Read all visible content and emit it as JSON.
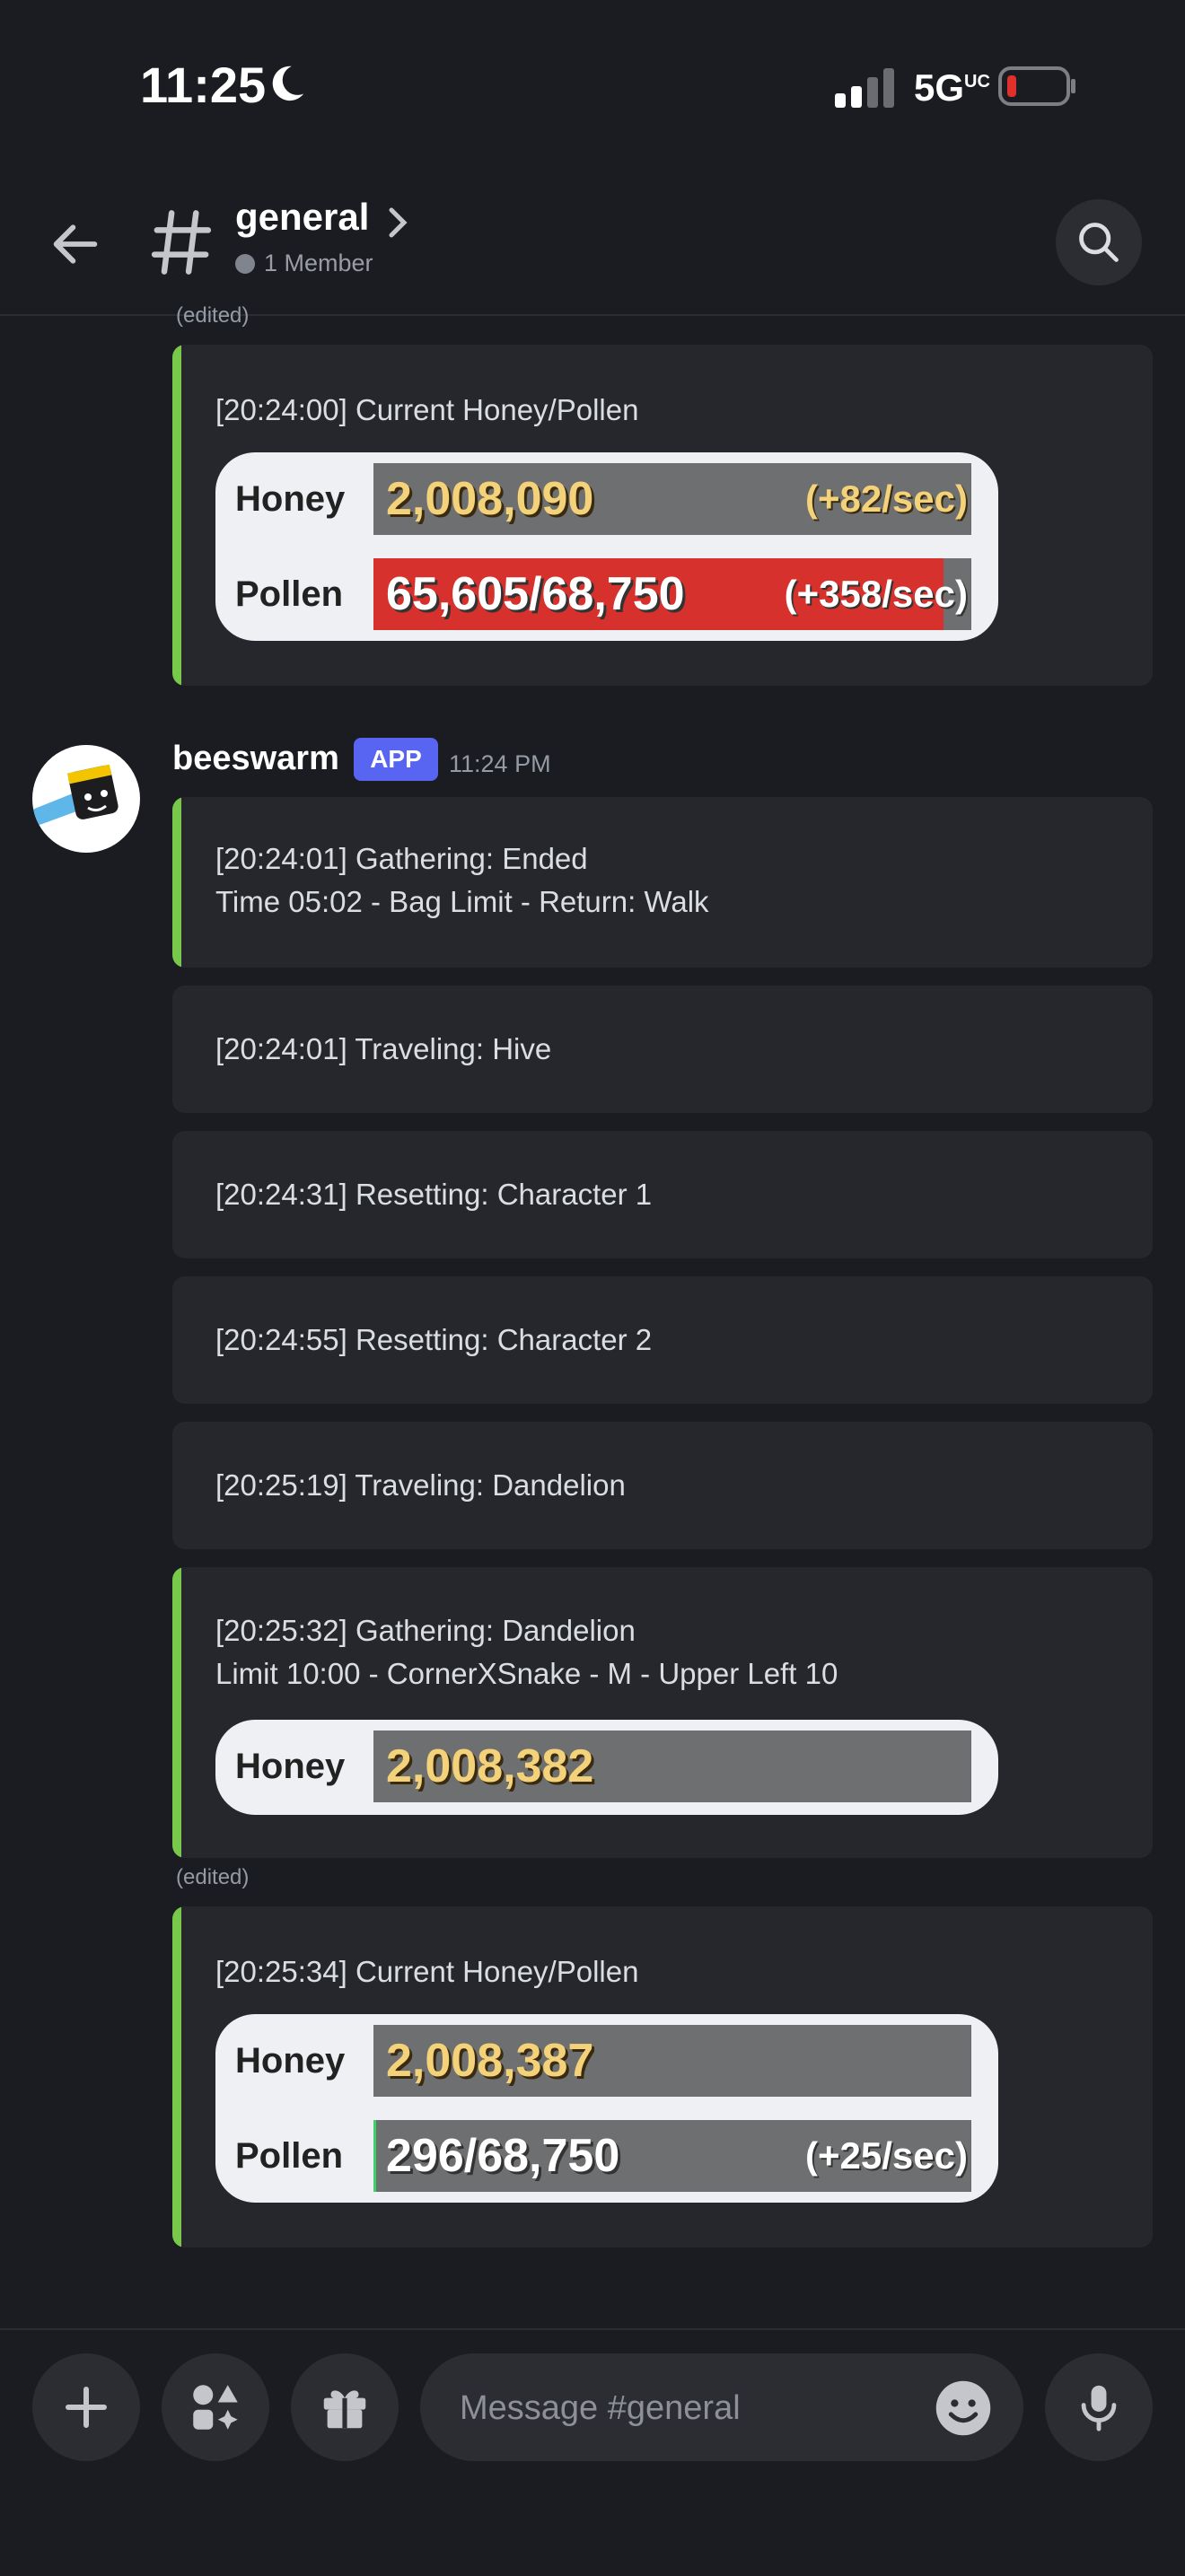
{
  "status_bar": {
    "time": "11:25",
    "network": "5G",
    "network_suffix": "UC"
  },
  "header": {
    "channel_name": "general",
    "member_count": "1 Member"
  },
  "edited_label": "(edited)",
  "messages": {
    "top_embed": {
      "line1": "[20:24:00] Current Honey/Pollen",
      "honey_label": "Honey",
      "honey_value": "2,008,090",
      "honey_rate": "(+82/sec)",
      "pollen_label": "Pollen",
      "pollen_value": "65,605/68,750",
      "pollen_rate": "(+358/sec)",
      "pollen_fill": 0.954
    },
    "author": {
      "name": "beeswarm",
      "badge": "APP",
      "time": "11:24 PM"
    },
    "embed1": {
      "line1": "[20:24:01] Gathering: Ended",
      "line2": "Time 05:02 - Bag Limit - Return: Walk"
    },
    "embed2": {
      "line1": "[20:24:01] Traveling: Hive"
    },
    "embed3": {
      "line1": "[20:24:31] Resetting: Character 1"
    },
    "embed4": {
      "line1": "[20:24:55] Resetting: Character 2"
    },
    "embed5": {
      "line1": "[20:25:19] Traveling: Dandelion"
    },
    "embed6": {
      "line1": "[20:25:32] Gathering: Dandelion",
      "line2": "Limit 10:00 - CornerXSnake - M - Upper Left 10",
      "honey_label": "Honey",
      "honey_value": "2,008,382"
    },
    "embed7": {
      "line1": "[20:25:34] Current Honey/Pollen",
      "honey_label": "Honey",
      "honey_value": "2,008,387",
      "pollen_label": "Pollen",
      "pollen_value": "296/68,750",
      "pollen_rate": "(+25/sec)",
      "pollen_fill": 0.004
    }
  },
  "composer": {
    "placeholder": "Message #general"
  },
  "colors": {
    "accent_green": "#78c84c",
    "app_badge": "#5865f2",
    "pollen_red": "#d6312c",
    "honey_gold": "#f4d27a"
  }
}
